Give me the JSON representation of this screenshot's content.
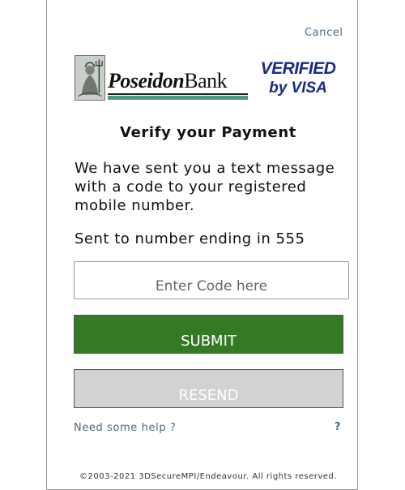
{
  "header": {
    "cancel_label": "Cancel"
  },
  "logos": {
    "bank": {
      "name_part1": "Poseidon",
      "name_part2": "Bank",
      "accent_color": "#4e9a7e"
    },
    "card_scheme": {
      "line1": "VERIFIED",
      "line2": "by VISA",
      "color": "#1a2a8a"
    }
  },
  "main": {
    "title": "Verify your Payment",
    "message": "We have sent you a text message with a code to your registered mobile number.",
    "sent_to": "Sent to number ending in 555",
    "code_input": {
      "placeholder": "Enter Code here",
      "value": ""
    },
    "submit_label": "SUBMIT",
    "resend_label": "RESEND"
  },
  "help": {
    "link_label": "Need some help ?",
    "icon_label": "?"
  },
  "footer": {
    "copyright": "©2003-2021 3DSecureMPI/Endeavour. All rights reserved."
  },
  "colors": {
    "submit": "#347a25",
    "resend": "#d2d2d2",
    "link": "#4a6a85"
  }
}
